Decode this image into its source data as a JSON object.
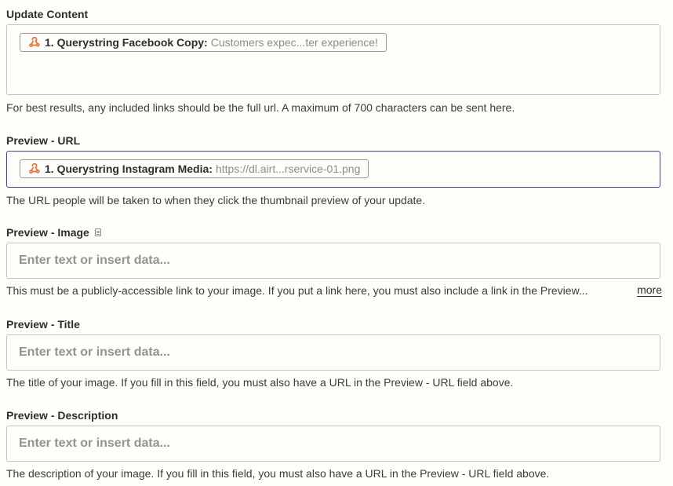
{
  "fields": [
    {
      "label": "Update Content",
      "pill": {
        "icon": "webhook-icon",
        "step": "1. Querystring Facebook Copy:",
        "value": "Customers expec...ter experience!"
      },
      "help": "For best results, any included links should be the full url. A maximum of 700 characters can be sent here."
    },
    {
      "label": "Preview - URL",
      "pill": {
        "icon": "webhook-icon",
        "step": "1. Querystring Instagram Media:",
        "value": "https://dl.airt...rservice-01.png"
      },
      "help": "The URL people will be taken to when they click the thumbnail preview of your update."
    },
    {
      "label": "Preview - Image",
      "placeholder": "Enter text or insert data...",
      "help": "This must be a publicly-accessible link to your image. If you put a link here, you must also include a link in the Preview...",
      "more": "more"
    },
    {
      "label": "Preview - Title",
      "placeholder": "Enter text or insert data...",
      "help": "The title of your image. If you fill in this field, you must also have a URL in the Preview - URL field above."
    },
    {
      "label": "Preview - Description",
      "placeholder": "Enter text or insert data...",
      "help": "The description of your image. If you fill in this field, you must also have a URL in the Preview - URL field above."
    }
  ],
  "colors": {
    "webhook_icon": "#e96b2e",
    "focused_border": "#3d4592"
  }
}
